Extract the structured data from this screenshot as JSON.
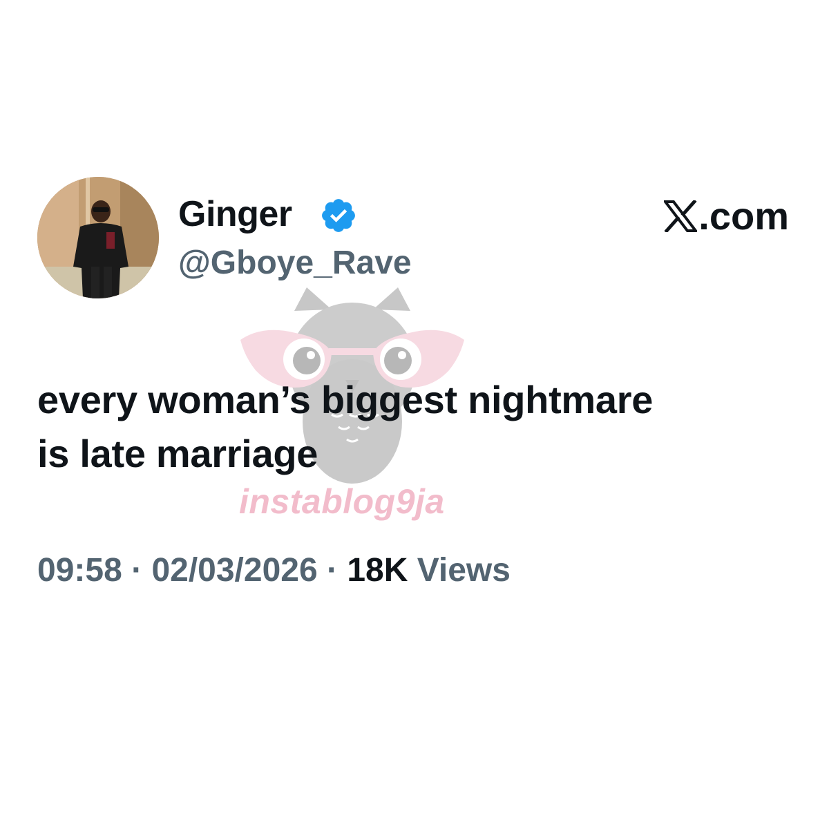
{
  "author": {
    "display_name": "Ginger",
    "handle": "@Gboye_Rave",
    "verified": true,
    "verified_color": "#1d9bf0",
    "avatar_icon": "profile-photo"
  },
  "source": {
    "label": ".com",
    "logo_icon": "x-logo-icon"
  },
  "tweet": {
    "lines": [
      "every woman’s biggest nightmare",
      "is late marriage"
    ]
  },
  "meta": {
    "time": "09:58",
    "separator": "·",
    "date": "02/03/2026",
    "views_count": "18K",
    "views_label": "Views"
  },
  "watermark": {
    "text": "instablog9ja",
    "icon": "owl-with-glasses-logo",
    "color": "#f2bccb"
  },
  "colors": {
    "primary_text": "#0f1419",
    "secondary_text": "#536471",
    "background": "#ffffff"
  }
}
